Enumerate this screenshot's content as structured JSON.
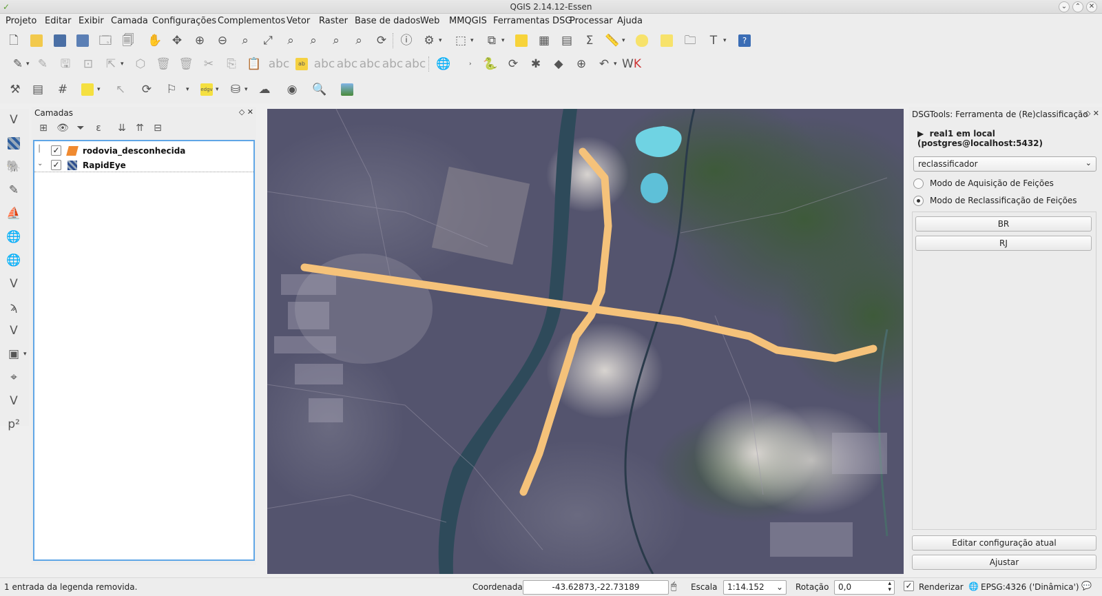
{
  "window": {
    "title": "QGIS 2.14.12-Essen"
  },
  "menu": [
    "Projeto",
    "Editar",
    "Exibir",
    "Camada",
    "Configurações",
    "Complementos",
    "Vetor",
    "Raster",
    "Base de dados",
    "Web",
    "MMQGIS",
    "Ferramentas DSG",
    "Processar",
    "Ajuda"
  ],
  "layers_panel": {
    "title": "Camadas",
    "layers": [
      {
        "name": "rodovia_desconhecida",
        "checked": true,
        "type": "vector-line"
      },
      {
        "name": "RapidEye",
        "checked": true,
        "type": "raster"
      }
    ]
  },
  "dsg_panel": {
    "title": "DSGTools: Ferramenta de (Re)classificação",
    "connection": "real1 em local (postgres@localhost:5432)",
    "profile": "reclassificador",
    "modes": [
      {
        "label": "Modo de Aquisição de Feições",
        "selected": false
      },
      {
        "label": "Modo de Reclassificação de Feições",
        "selected": true
      }
    ],
    "buttons": [
      "BR",
      "RJ"
    ],
    "edit_button": "Editar configuração atual",
    "adjust_button": "Ajustar"
  },
  "status": {
    "message": "1 entrada da legenda removida.",
    "coord_label": "Coordenada",
    "coord_value": "-43.62873,-22.73189",
    "scale_label": "Escala",
    "scale_value": "1:14.152",
    "rotation_label": "Rotação",
    "rotation_value": "0,0",
    "render_label": "Renderizar",
    "render_checked": true,
    "crs": "EPSG:4326 ('Dinâmica')"
  },
  "colors": {
    "road": "#f5c27a",
    "accent": "#5fa6e6"
  }
}
